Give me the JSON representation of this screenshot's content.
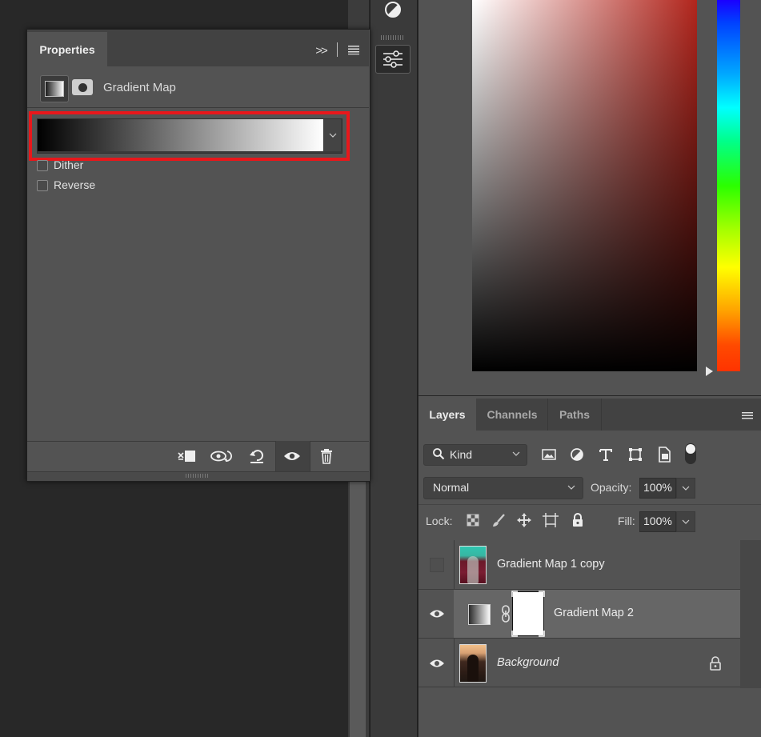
{
  "properties": {
    "tab_label": "Properties",
    "collapse_label": ">>",
    "title": "Gradient Map",
    "gradient": {
      "start_color": "#000000",
      "end_color": "#ffffff"
    },
    "dither_label": "Dither",
    "reverse_label": "Reverse",
    "dither_checked": false,
    "reverse_checked": false,
    "footer_icons": [
      "clip-to-layer-icon",
      "view-previous-state-icon",
      "reset-icon",
      "visibility-icon",
      "trash-icon"
    ]
  },
  "color_picker": {
    "base_hue_color": "#b1251c"
  },
  "layers": {
    "tabs": [
      "Layers",
      "Channels",
      "Paths"
    ],
    "filter": {
      "kind_label": "Kind",
      "icons": [
        "pixel-filter-icon",
        "adjustment-filter-icon",
        "type-filter-icon",
        "shape-filter-icon",
        "smart-object-filter-icon"
      ]
    },
    "blend_mode": "Normal",
    "opacity_label": "Opacity:",
    "opacity_value": "100%",
    "lock_label": "Lock:",
    "fill_label": "Fill:",
    "fill_value": "100%",
    "items": [
      {
        "name": "Gradient Map 1 copy",
        "visible": false,
        "selected": false
      },
      {
        "name": "Gradient Map 2",
        "visible": true,
        "selected": true
      },
      {
        "name": "Background",
        "visible": true,
        "selected": false,
        "locked": true
      }
    ]
  },
  "colors": {
    "highlight": "#e8171b",
    "panel": "#535353",
    "selected_row": "#666666"
  }
}
